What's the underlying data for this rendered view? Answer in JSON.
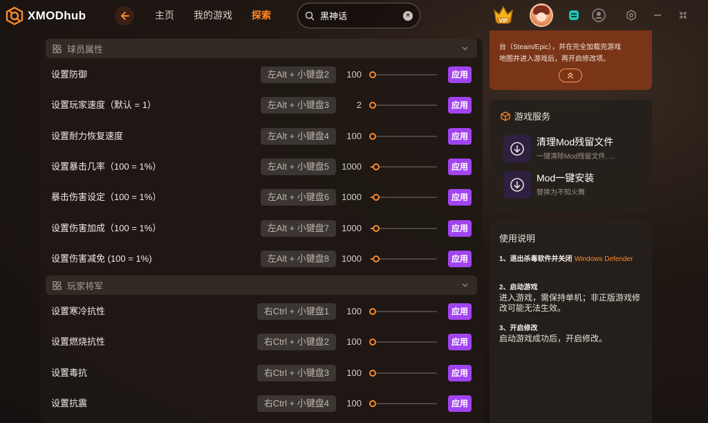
{
  "app": {
    "name": "XMODhub",
    "colors": {
      "accent": "#ff8a2b",
      "apply": "#a144f0",
      "notice_bg": "#7a3417"
    }
  },
  "nav": {
    "items": [
      {
        "label": "主页",
        "active": false
      },
      {
        "label": "我的游戏",
        "active": false
      },
      {
        "label": "探索",
        "active": true
      }
    ]
  },
  "search": {
    "value": "黑神话",
    "placeholder": ""
  },
  "vip": {
    "label": "VIP"
  },
  "sections": [
    {
      "title": "球员属性",
      "rows": [
        {
          "label": "设置防御",
          "hotkey": "左Alt + 小键盘2",
          "value": "100",
          "level": 0.0,
          "apply": "应用"
        },
        {
          "label": "设置玩家速度（默认 = 1）",
          "hotkey": "左Alt + 小键盘3",
          "value": "2",
          "level": 0.0,
          "apply": "应用"
        },
        {
          "label": "设置耐力恢复速度",
          "hotkey": "左Alt + 小键盘4",
          "value": "100",
          "level": 0.0,
          "apply": "应用"
        },
        {
          "label": "设置暴击几率（100 = 1%）",
          "hotkey": "左Alt + 小键盘5",
          "value": "1000",
          "level": 0.05,
          "apply": "应用"
        },
        {
          "label": "暴击伤害设定（100 = 1%）",
          "hotkey": "左Alt + 小键盘6",
          "value": "1000",
          "level": 0.05,
          "apply": "应用"
        },
        {
          "label": "设置伤害加成（100 = 1%）",
          "hotkey": "左Alt + 小键盘7",
          "value": "1000",
          "level": 0.05,
          "apply": "应用"
        },
        {
          "label": "设置伤害减免 (100 = 1%)",
          "hotkey": "左Alt + 小键盘8",
          "value": "1000",
          "level": 0.05,
          "apply": "应用"
        }
      ]
    },
    {
      "title": "玩家将军",
      "rows": [
        {
          "label": "设置寒冷抗性",
          "hotkey": "右Ctrl + 小键盘1",
          "value": "100",
          "level": 0.0,
          "apply": "应用"
        },
        {
          "label": "设置燃烧抗性",
          "hotkey": "右Ctrl + 小键盘2",
          "value": "100",
          "level": 0.0,
          "apply": "应用"
        },
        {
          "label": "设置毒抗",
          "hotkey": "右Ctrl + 小键盘3",
          "value": "100",
          "level": 0.0,
          "apply": "应用"
        },
        {
          "label": "设置抗震",
          "hotkey": "右Ctrl + 小键盘4",
          "value": "100",
          "level": 0.0,
          "apply": "应用"
        }
      ]
    }
  ],
  "notice": {
    "line1": "台（Steam/Epic），并在完全加载完游戏",
    "line2": "地图并进入游戏后，再开启修改项。"
  },
  "services": {
    "title": "游戏服务",
    "items": [
      {
        "name": "清理Mod残留文件",
        "desc": "一键清除Mod残留文件, ..."
      },
      {
        "name": "Mod一键安装",
        "desc": "替换为不知火舞"
      }
    ]
  },
  "guide": {
    "title": "使用说明",
    "steps": [
      {
        "head": "1、退出杀毒软件并关闭",
        "head_highlight": "Windows Defender",
        "body": ""
      },
      {
        "head": "2、启动游戏",
        "head_highlight": "",
        "body": "进入游戏，需保持单机；非正版游戏修改可能无法生效。"
      },
      {
        "head": "3、开启修改",
        "head_highlight": "",
        "body": "启动游戏成功后，开启修改。"
      }
    ]
  },
  "icons": {
    "logo": "xmod-logo-icon",
    "back": "arrow-left-icon",
    "search": "search-icon",
    "clear": "clear-icon",
    "vip": "vip-crown-icon",
    "window": [
      "mod-manager-icon",
      "user-silhouette-icon",
      "settings-icon",
      "minimize-icon",
      "shrink-icon"
    ]
  }
}
